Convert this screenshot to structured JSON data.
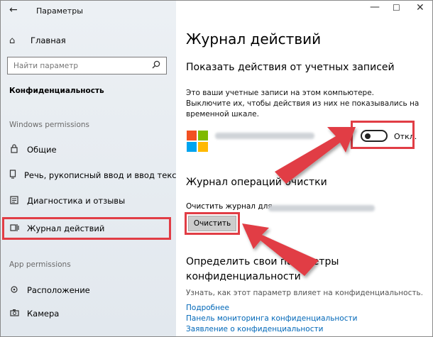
{
  "window": {
    "title": "Параметры"
  },
  "sidebar": {
    "home_label": "Главная",
    "search_placeholder": "Найти параметр",
    "category_title": "Конфиденциальность",
    "groups": [
      {
        "label": "Windows permissions"
      },
      {
        "label": "App permissions"
      }
    ],
    "items": [
      {
        "label": "Общие",
        "icon": "lock-icon"
      },
      {
        "label": "Речь, рукописный ввод и ввод текста",
        "icon": "speech-icon"
      },
      {
        "label": "Диагностика и отзывы",
        "icon": "feedback-icon"
      },
      {
        "label": "Журнал действий",
        "icon": "timeline-icon",
        "selected": true
      },
      {
        "label": "Расположение",
        "icon": "location-icon"
      },
      {
        "label": "Камера",
        "icon": "camera-icon"
      }
    ]
  },
  "main": {
    "title": "Журнал действий",
    "accounts_section": {
      "title": "Показать действия от учетных записей",
      "description": "Это ваши учетные записи на этом компьютере. Выключите их, чтобы действия из них не показывались на временной шкале.",
      "toggle_state": "Откл.",
      "toggle_on": false
    },
    "clear_section": {
      "title": "Журнал операций очистки",
      "label": "Очистить журнал для",
      "button_label": "Очистить"
    },
    "privacy_section": {
      "title_line1": "Определить свои параметры",
      "title_line2": "конфиденциальности",
      "text": "Узнать, как этот параметр влияет на конфиденциальность.",
      "links": [
        "Подробнее",
        "Панель мониторинга конфиденциальности",
        "Заявление о конфиденциальности"
      ]
    }
  },
  "colors": {
    "highlight": "#e13d45",
    "link": "#0067b8",
    "ms_red": "#f25022",
    "ms_green": "#7fba00",
    "ms_blue": "#00a4ef",
    "ms_yellow": "#ffb900"
  }
}
